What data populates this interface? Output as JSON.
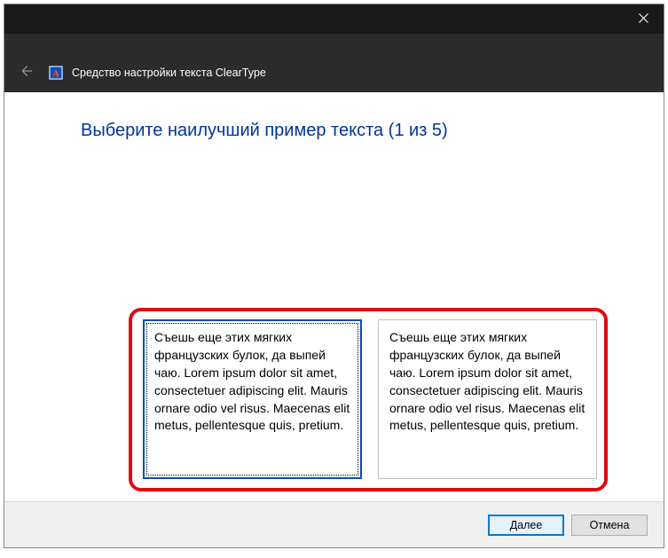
{
  "titlebar": {
    "app_title": "Средство настройки текста ClearType"
  },
  "main": {
    "instruction": "Выберите наилучший пример текста (1 из 5)",
    "samples": [
      {
        "text": "Съешь еще этих мягких французских булок, да выпей чаю. Lorem ipsum dolor sit amet, consectetuer adipiscing elit. Mauris ornare odio vel risus. Maecenas elit metus, pellentesque quis, pretium.",
        "selected": true
      },
      {
        "text": "Съешь еще этих мягких французских булок, да выпей чаю. Lorem ipsum dolor sit amet, consectetuer adipiscing elit. Mauris ornare odio vel risus. Maecenas elit metus, pellentesque quis, pretium.",
        "selected": false
      }
    ]
  },
  "footer": {
    "next_label": "Далее",
    "cancel_label": "Отмена"
  }
}
